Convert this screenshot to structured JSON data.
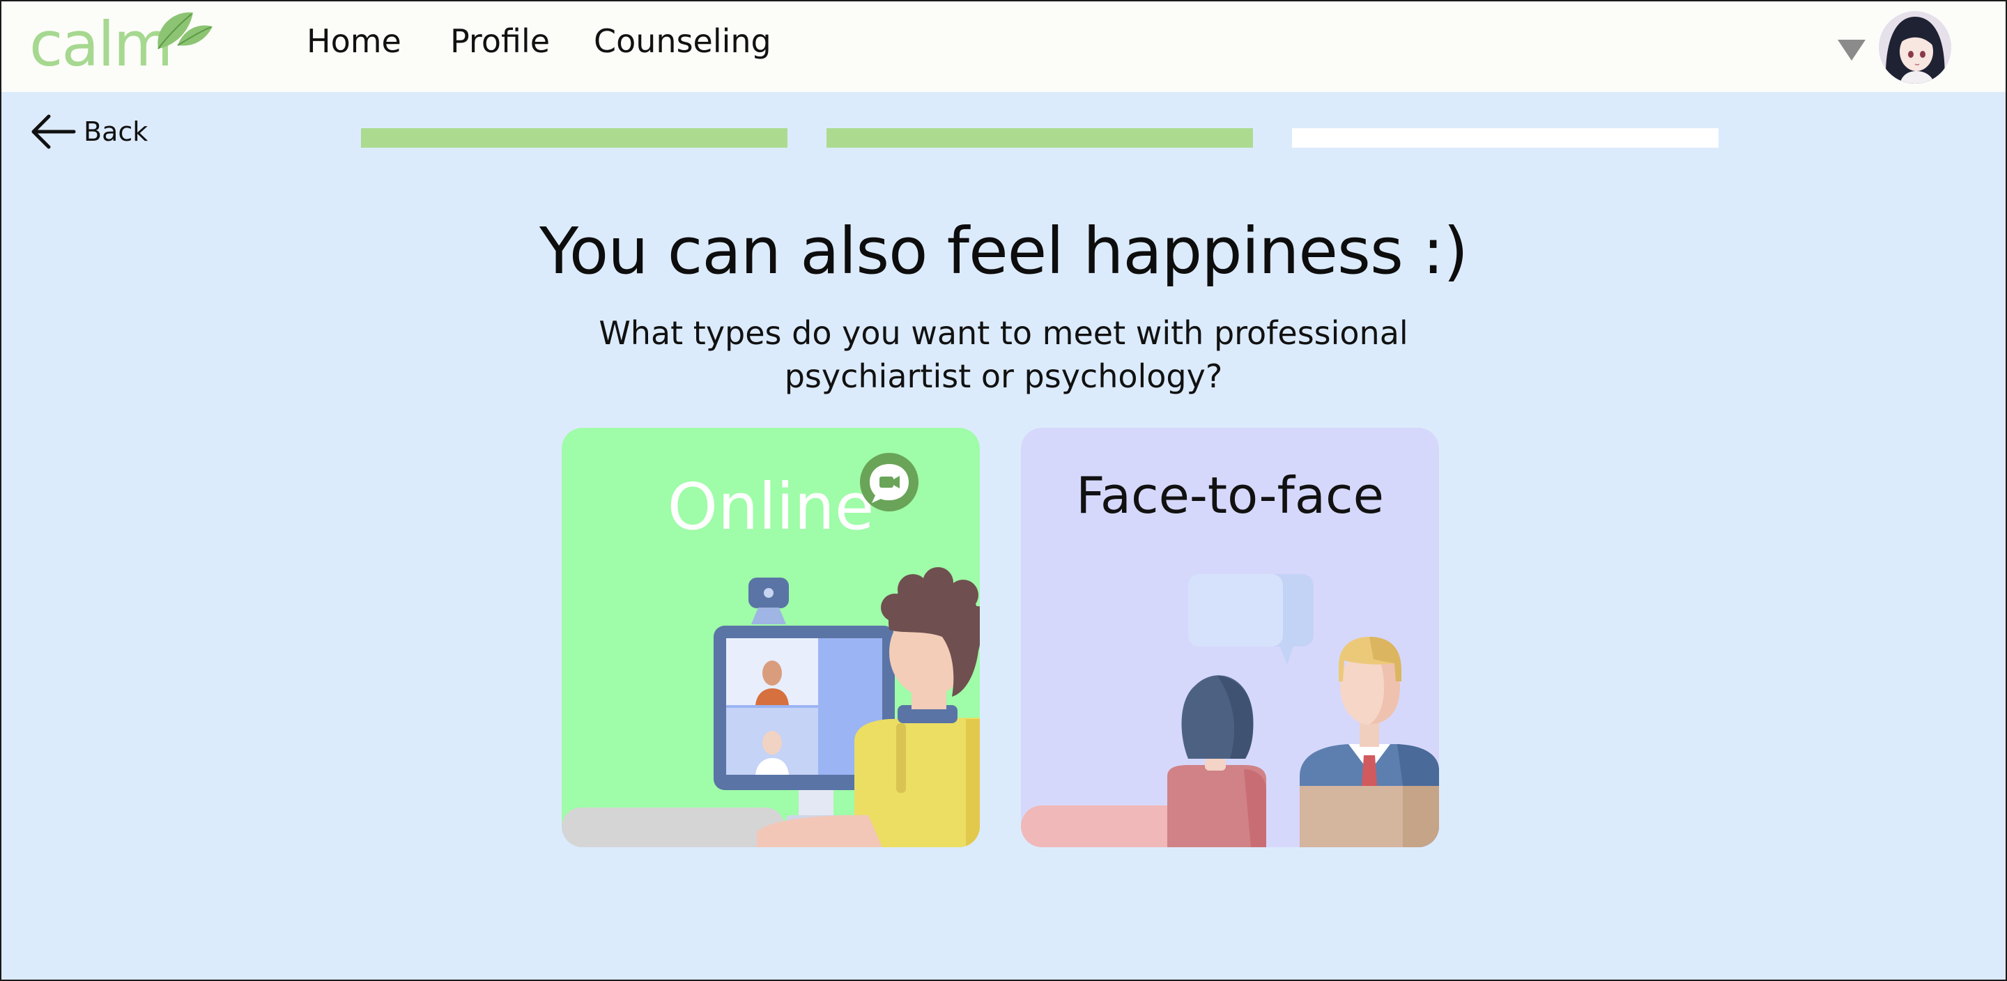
{
  "brand": {
    "name": "calm",
    "color": "#a6d890"
  },
  "nav": {
    "items": [
      {
        "label": "Home"
      },
      {
        "label": "Profile"
      },
      {
        "label": "Counseling"
      }
    ]
  },
  "user": {
    "avatar_icon": "user-avatar",
    "menu_icon": "caret-down-icon"
  },
  "back": {
    "label": "Back",
    "icon": "arrow-left-icon"
  },
  "progress": {
    "total_steps": 3,
    "completed_steps": 2,
    "complete_color": "#acdb90",
    "pending_color": "#ffffff"
  },
  "page": {
    "headline": "You can also feel happiness :)",
    "subtitle_line1": "What types do you want to meet with professional",
    "subtitle_line2": "psychiartist or psychology?"
  },
  "options": [
    {
      "id": "online",
      "title": "Online",
      "color": "#9ffca8",
      "badge_icon": "video-chat-icon"
    },
    {
      "id": "face-to-face",
      "title": "Face-to-face",
      "color": "#d6d8fb"
    }
  ]
}
